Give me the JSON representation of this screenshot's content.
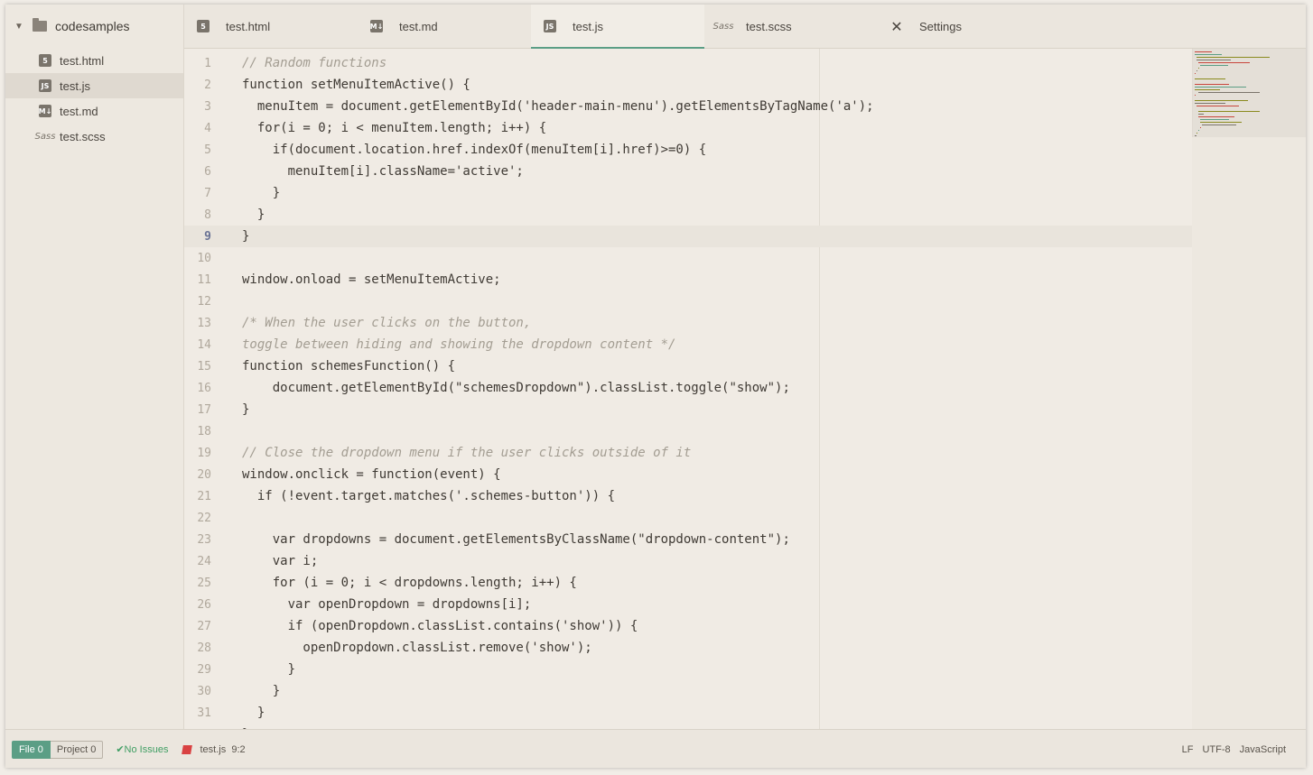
{
  "sidebar": {
    "root": "codesamples",
    "files": [
      {
        "label": "test.html",
        "icon": "html5-icon",
        "glyph": "5"
      },
      {
        "label": "test.js",
        "icon": "js-icon",
        "glyph": "JS"
      },
      {
        "label": "test.md",
        "icon": "markdown-icon",
        "glyph": "M↓"
      },
      {
        "label": "test.scss",
        "icon": "sass-icon",
        "glyph": "Sass"
      }
    ]
  },
  "tabs": [
    {
      "label": "test.html",
      "glyph": "5"
    },
    {
      "label": "test.md",
      "glyph": "M↓"
    },
    {
      "label": "test.js",
      "glyph": "JS"
    },
    {
      "label": "test.scss",
      "glyph": "Sass"
    },
    {
      "label": "Settings",
      "glyph": "✕"
    }
  ],
  "editor": {
    "current_line": 9,
    "lines": [
      "// Random functions",
      "function setMenuItemActive() {",
      "  menuItem = document.getElementById('header-main-menu').getElementsByTagName('a');",
      "  for(i = 0; i < menuItem.length; i++) {",
      "    if(document.location.href.indexOf(menuItem[i].href)>=0) {",
      "      menuItem[i].className='active';",
      "    }",
      "  }",
      "}",
      "",
      "window.onload = setMenuItemActive;",
      "",
      "/* When the user clicks on the button,",
      "toggle between hiding and showing the dropdown content */",
      "function schemesFunction() {",
      "    document.getElementById(\"schemesDropdown\").classList.toggle(\"show\");",
      "}",
      "",
      "// Close the dropdown menu if the user clicks outside of it",
      "window.onclick = function(event) {",
      "  if (!event.target.matches('.schemes-button')) {",
      "",
      "    var dropdowns = document.getElementsByClassName(\"dropdown-content\");",
      "    var i;",
      "    for (i = 0; i < dropdowns.length; i++) {",
      "      var openDropdown = dropdowns[i];",
      "      if (openDropdown.classList.contains('show')) {",
      "        openDropdown.classList.remove('show');",
      "      }",
      "    }",
      "  }",
      "};"
    ]
  },
  "status": {
    "file_label": "File 0",
    "project_label": "Project 0",
    "issues": "No Issues",
    "file_name": "test.js",
    "cursor": "9:2",
    "line_ending": "LF",
    "encoding": "UTF-8",
    "grammar": "JavaScript"
  },
  "colors": {
    "accent": "#5b9e85",
    "comment": "#a39d92",
    "string": "#5b9e85",
    "keyword": "#8a8a1e",
    "identifier": "#c8463d"
  }
}
